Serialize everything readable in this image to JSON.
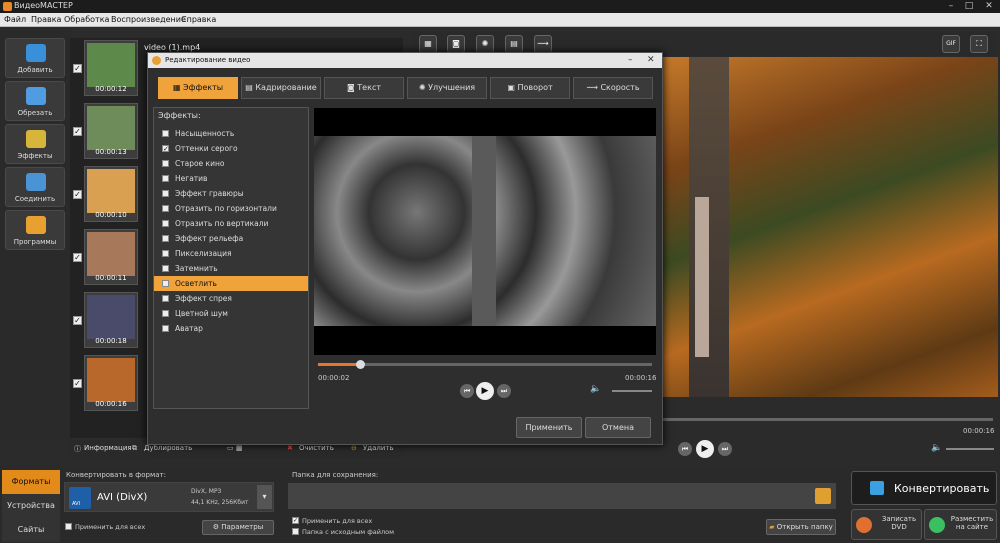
{
  "app": {
    "title": "ВидеоМАСТЕР"
  },
  "menu": [
    "Файл",
    "Правка",
    "Обработка",
    "Воспроизведение",
    "Справка"
  ],
  "leftbar": [
    {
      "label": "Добавить",
      "icon": "add-video-icon",
      "color": "#3a8fd9"
    },
    {
      "label": "Обрезать",
      "icon": "cut-icon",
      "color": "#3a8fd9"
    },
    {
      "label": "Эффекты",
      "icon": "effects-icon",
      "color": "#3a8fd9"
    },
    {
      "label": "Соединить",
      "icon": "join-icon",
      "color": "#3a8fd9"
    },
    {
      "label": "Программы",
      "icon": "programs-icon",
      "color": "#e8a030"
    }
  ],
  "files": [
    {
      "name": "video (1).mp4",
      "duration": "00:00:12",
      "checked": "✓",
      "color": "#5d8a4a"
    },
    {
      "duration": "00:00:13",
      "checked": "✓",
      "color": "#6e8c5a"
    },
    {
      "duration": "00:00:10",
      "checked": "✓",
      "color": "#d8a050"
    },
    {
      "duration": "00:00:11",
      "checked": "✓",
      "color": "#a8785a"
    },
    {
      "duration": "00:00:18",
      "checked": "✓",
      "color": "#4a4a6a"
    },
    {
      "duration": "00:00:16",
      "checked": "✓",
      "color": "#b8682a"
    }
  ],
  "filetools": {
    "info": "Информация",
    "duplicate": "Дублировать",
    "clear": "Очистить",
    "delete": "Удалить"
  },
  "toptools": {
    "gif": "GIF"
  },
  "main_player": {
    "time": "00:00:16"
  },
  "dialog": {
    "title": "Редактирование видео",
    "tabs": [
      "Эффекты",
      "Кадрирование",
      "Текст",
      "Улучшения",
      "Поворот",
      "Скорость"
    ],
    "effects_label": "Эффекты:",
    "effects": [
      {
        "label": "Насыщенность",
        "check": ""
      },
      {
        "label": "Оттенки серого",
        "check": "✓"
      },
      {
        "label": "Старое кино",
        "check": ""
      },
      {
        "label": "Негатив",
        "check": ""
      },
      {
        "label": "Эффект гравюры",
        "check": ""
      },
      {
        "label": "Отразить по горизонтали",
        "check": ""
      },
      {
        "label": "Отразить по вертикали",
        "check": ""
      },
      {
        "label": "Эффект рельефа",
        "check": ""
      },
      {
        "label": "Пикселизация",
        "check": ""
      },
      {
        "label": "Затемнить",
        "check": ""
      },
      {
        "label": "Осветлить",
        "check": ""
      },
      {
        "label": "Эффект спрея",
        "check": ""
      },
      {
        "label": "Цветной шум",
        "check": ""
      },
      {
        "label": "Аватар",
        "check": ""
      }
    ],
    "time_current": "00:00:02",
    "time_total": "00:00:16",
    "progress": 0.125,
    "apply": "Применить",
    "cancel": "Отмена"
  },
  "bottom": {
    "tabs": [
      "Форматы",
      "Устройства",
      "Сайты"
    ],
    "convert_to_label": "Конвертировать в формат:",
    "format_name": "AVI (DivX)",
    "format_badge": "AVI",
    "format_codec": "DivX, MP3",
    "format_audio": "44,1 KHz, 256Кбит",
    "apply_all": "Применить для всех",
    "params": "Параметры",
    "save_folder_label": "Папка для сохранения:",
    "apply_all2": "Применить для всех",
    "source_folder": "Папка с исходным файлом",
    "open_folder": "Открыть папку",
    "convert": "Конвертировать",
    "burn_dvd": "Записать DVD",
    "publish": "Разместить на сайте"
  }
}
